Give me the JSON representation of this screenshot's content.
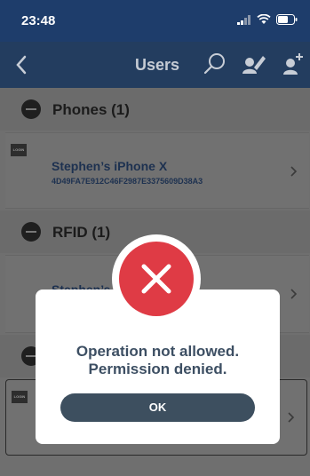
{
  "status_bar": {
    "time": "23:48"
  },
  "nav": {
    "title": "Users"
  },
  "sections": [
    {
      "title": "Phones (1)",
      "items": [
        {
          "badge": "LOGIN",
          "name": "Stephen’s iPhone X",
          "id": "4D49FA7E912C46F2987E3375609D38A3"
        }
      ]
    },
    {
      "title": "RFID (1)",
      "items": [
        {
          "name": "Stephen’s"
        }
      ]
    },
    {
      "items": [
        {
          "badge": "LOGIN"
        }
      ]
    }
  ],
  "dialog": {
    "line1": "Operation not allowed.",
    "line2": "Permission denied.",
    "ok_label": "OK"
  },
  "colors": {
    "nav_bg": "#233d5f",
    "error_red": "#df3b45",
    "button_bg": "#3d4f5f"
  }
}
